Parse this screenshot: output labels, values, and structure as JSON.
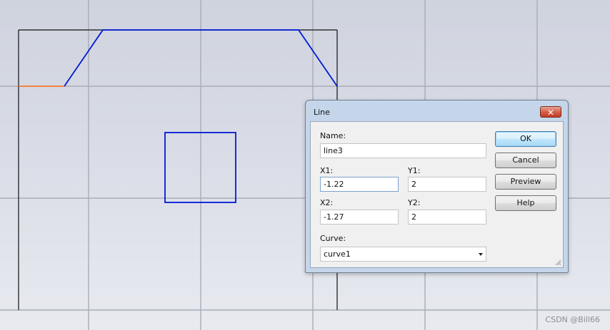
{
  "dialog": {
    "title": "Line",
    "close_label": "✕",
    "fields": {
      "name_label": "Name:",
      "name_value": "line3",
      "x1_label": "X1:",
      "x1_value": "-1.22",
      "y1_label": "Y1:",
      "y1_value": "2",
      "x2_label": "X2:",
      "x2_value": "-1.27",
      "y2_label": "Y2:",
      "y2_value": "2",
      "curve_label": "Curve:",
      "curve_value": "curve1"
    },
    "buttons": {
      "ok": "OK",
      "cancel": "Cancel",
      "preview": "Preview",
      "help": "Help"
    }
  },
  "colors": {
    "shape_blue": "#0019d6",
    "highlight_orange": "#ff7a2e",
    "outline_black": "#111111",
    "grid": "#a9acb3"
  },
  "watermark": "CSDN @Bill66"
}
